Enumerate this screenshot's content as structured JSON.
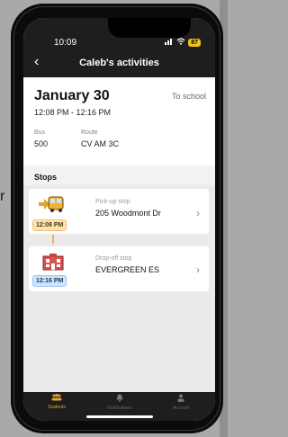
{
  "edge_glyph": "r",
  "status": {
    "time": "10:09",
    "battery": "87"
  },
  "header": {
    "title": "Caleb's activities",
    "back_glyph": "‹"
  },
  "trip": {
    "date": "January 30",
    "direction": "To school",
    "time_range": "12:08 PM - 12:16 PM",
    "bus_label": "Bus",
    "bus_value": "500",
    "route_label": "Route",
    "route_value": "CV AM 3C"
  },
  "stops": {
    "heading": "Stops",
    "items": [
      {
        "kind": "Pick-up stop",
        "name": "205 Woodmont Dr",
        "time": "12:08 PM",
        "icon": "bus-stop-icon"
      },
      {
        "kind": "Drop-off stop",
        "name": "EVERGREEN ES",
        "time": "12:16 PM",
        "icon": "school-icon"
      }
    ]
  },
  "tabs": [
    {
      "label": "Students",
      "icon": "students-icon",
      "active": true
    },
    {
      "label": "Notifications",
      "icon": "bell-icon",
      "active": false
    },
    {
      "label": "Account",
      "icon": "account-icon",
      "active": false
    }
  ],
  "colors": {
    "accent": "#e0a32e",
    "pickup_badge": "#fbe2b0",
    "dropoff_badge": "#cfe4fb"
  }
}
